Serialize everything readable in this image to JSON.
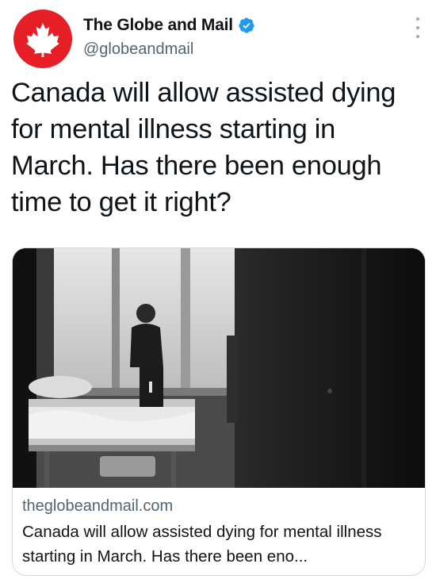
{
  "account": {
    "display_name": "The Globe and Mail",
    "handle": "@globeandmail",
    "verified": true,
    "avatar_icon": "maple-leaf-icon",
    "avatar_color": "#e51f25"
  },
  "tweet": {
    "text": "Canada will allow assisted dying for mental illness starting in March. Has there been enough time to get it right?"
  },
  "link_card": {
    "image_description_icon": "photo",
    "domain": "theglobeandmail.com",
    "title": "Canada will allow assisted dying for mental illness starting in March. Has there been eno..."
  },
  "colors": {
    "verified_blue": "#1d9bf0",
    "secondary_text": "#536471",
    "primary_text": "#0f1419"
  }
}
